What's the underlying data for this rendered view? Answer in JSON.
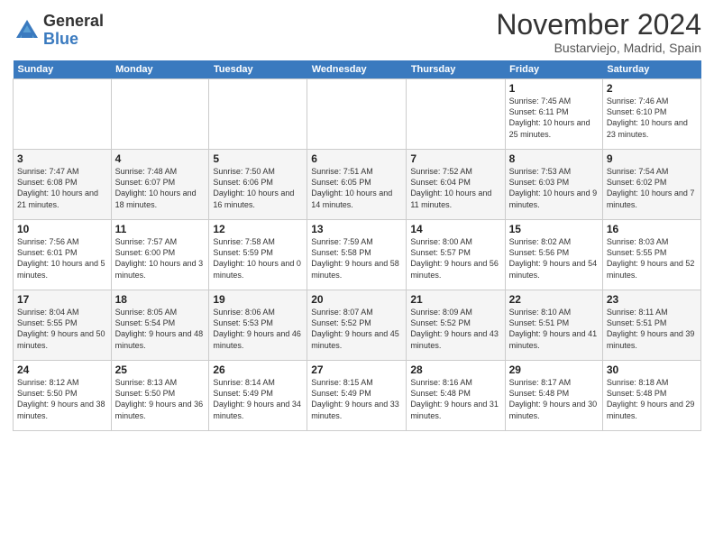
{
  "header": {
    "logo_general": "General",
    "logo_blue": "Blue",
    "month_title": "November 2024",
    "location": "Bustarviejo, Madrid, Spain"
  },
  "weekdays": [
    "Sunday",
    "Monday",
    "Tuesday",
    "Wednesday",
    "Thursday",
    "Friday",
    "Saturday"
  ],
  "weeks": [
    [
      {
        "day": "",
        "info": ""
      },
      {
        "day": "",
        "info": ""
      },
      {
        "day": "",
        "info": ""
      },
      {
        "day": "",
        "info": ""
      },
      {
        "day": "",
        "info": ""
      },
      {
        "day": "1",
        "info": "Sunrise: 7:45 AM\nSunset: 6:11 PM\nDaylight: 10 hours and 25 minutes."
      },
      {
        "day": "2",
        "info": "Sunrise: 7:46 AM\nSunset: 6:10 PM\nDaylight: 10 hours and 23 minutes."
      }
    ],
    [
      {
        "day": "3",
        "info": "Sunrise: 7:47 AM\nSunset: 6:08 PM\nDaylight: 10 hours and 21 minutes."
      },
      {
        "day": "4",
        "info": "Sunrise: 7:48 AM\nSunset: 6:07 PM\nDaylight: 10 hours and 18 minutes."
      },
      {
        "day": "5",
        "info": "Sunrise: 7:50 AM\nSunset: 6:06 PM\nDaylight: 10 hours and 16 minutes."
      },
      {
        "day": "6",
        "info": "Sunrise: 7:51 AM\nSunset: 6:05 PM\nDaylight: 10 hours and 14 minutes."
      },
      {
        "day": "7",
        "info": "Sunrise: 7:52 AM\nSunset: 6:04 PM\nDaylight: 10 hours and 11 minutes."
      },
      {
        "day": "8",
        "info": "Sunrise: 7:53 AM\nSunset: 6:03 PM\nDaylight: 10 hours and 9 minutes."
      },
      {
        "day": "9",
        "info": "Sunrise: 7:54 AM\nSunset: 6:02 PM\nDaylight: 10 hours and 7 minutes."
      }
    ],
    [
      {
        "day": "10",
        "info": "Sunrise: 7:56 AM\nSunset: 6:01 PM\nDaylight: 10 hours and 5 minutes."
      },
      {
        "day": "11",
        "info": "Sunrise: 7:57 AM\nSunset: 6:00 PM\nDaylight: 10 hours and 3 minutes."
      },
      {
        "day": "12",
        "info": "Sunrise: 7:58 AM\nSunset: 5:59 PM\nDaylight: 10 hours and 0 minutes."
      },
      {
        "day": "13",
        "info": "Sunrise: 7:59 AM\nSunset: 5:58 PM\nDaylight: 9 hours and 58 minutes."
      },
      {
        "day": "14",
        "info": "Sunrise: 8:00 AM\nSunset: 5:57 PM\nDaylight: 9 hours and 56 minutes."
      },
      {
        "day": "15",
        "info": "Sunrise: 8:02 AM\nSunset: 5:56 PM\nDaylight: 9 hours and 54 minutes."
      },
      {
        "day": "16",
        "info": "Sunrise: 8:03 AM\nSunset: 5:55 PM\nDaylight: 9 hours and 52 minutes."
      }
    ],
    [
      {
        "day": "17",
        "info": "Sunrise: 8:04 AM\nSunset: 5:55 PM\nDaylight: 9 hours and 50 minutes."
      },
      {
        "day": "18",
        "info": "Sunrise: 8:05 AM\nSunset: 5:54 PM\nDaylight: 9 hours and 48 minutes."
      },
      {
        "day": "19",
        "info": "Sunrise: 8:06 AM\nSunset: 5:53 PM\nDaylight: 9 hours and 46 minutes."
      },
      {
        "day": "20",
        "info": "Sunrise: 8:07 AM\nSunset: 5:52 PM\nDaylight: 9 hours and 45 minutes."
      },
      {
        "day": "21",
        "info": "Sunrise: 8:09 AM\nSunset: 5:52 PM\nDaylight: 9 hours and 43 minutes."
      },
      {
        "day": "22",
        "info": "Sunrise: 8:10 AM\nSunset: 5:51 PM\nDaylight: 9 hours and 41 minutes."
      },
      {
        "day": "23",
        "info": "Sunrise: 8:11 AM\nSunset: 5:51 PM\nDaylight: 9 hours and 39 minutes."
      }
    ],
    [
      {
        "day": "24",
        "info": "Sunrise: 8:12 AM\nSunset: 5:50 PM\nDaylight: 9 hours and 38 minutes."
      },
      {
        "day": "25",
        "info": "Sunrise: 8:13 AM\nSunset: 5:50 PM\nDaylight: 9 hours and 36 minutes."
      },
      {
        "day": "26",
        "info": "Sunrise: 8:14 AM\nSunset: 5:49 PM\nDaylight: 9 hours and 34 minutes."
      },
      {
        "day": "27",
        "info": "Sunrise: 8:15 AM\nSunset: 5:49 PM\nDaylight: 9 hours and 33 minutes."
      },
      {
        "day": "28",
        "info": "Sunrise: 8:16 AM\nSunset: 5:48 PM\nDaylight: 9 hours and 31 minutes."
      },
      {
        "day": "29",
        "info": "Sunrise: 8:17 AM\nSunset: 5:48 PM\nDaylight: 9 hours and 30 minutes."
      },
      {
        "day": "30",
        "info": "Sunrise: 8:18 AM\nSunset: 5:48 PM\nDaylight: 9 hours and 29 minutes."
      }
    ]
  ]
}
